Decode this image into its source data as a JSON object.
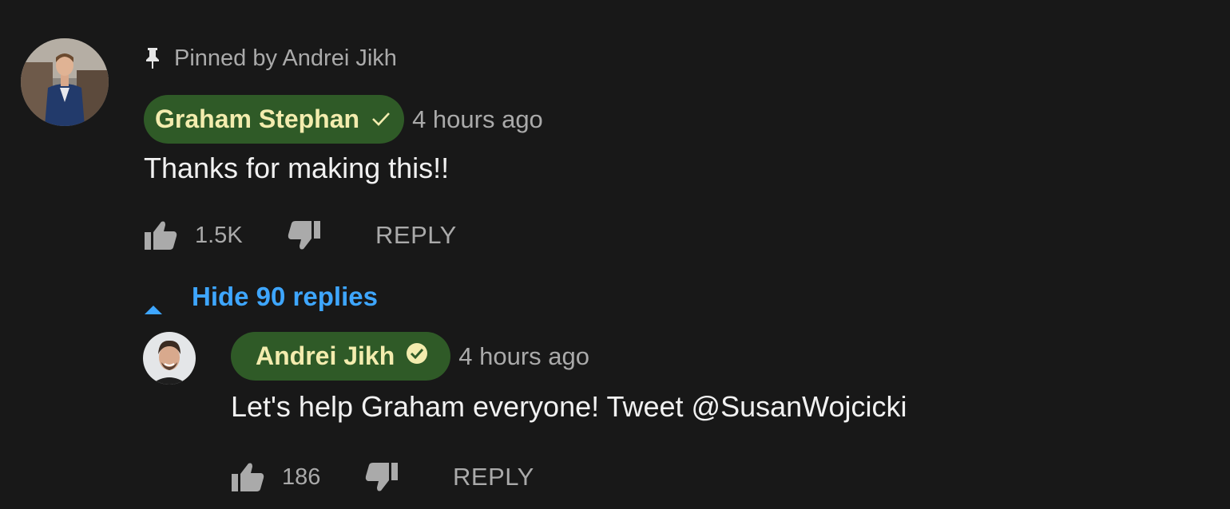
{
  "thread": {
    "pinned_label": "Pinned by Andrei Jikh",
    "hide_replies_label": "Hide 90 replies"
  },
  "top_comment": {
    "author": "Graham Stephan",
    "time": "4 hours ago",
    "text": "Thanks for making this!!",
    "like_count": "1.5K",
    "reply_label": "REPLY"
  },
  "reply_comment": {
    "author": "Andrei Jikh",
    "time": "4 hours ago",
    "text": "Let's help Graham everyone! Tweet @SusanWojcicki",
    "like_count": "186",
    "reply_label": "REPLY"
  },
  "colors": {
    "background": "#181818",
    "author_chip": "#2f5a27",
    "author_text": "#f3ecae",
    "link_blue": "#3ea6ff"
  },
  "icons": [
    "pin-icon",
    "verified-check-icon",
    "verified-badge-icon",
    "thumbs-up-icon",
    "thumbs-down-icon",
    "caret-up-icon"
  ]
}
